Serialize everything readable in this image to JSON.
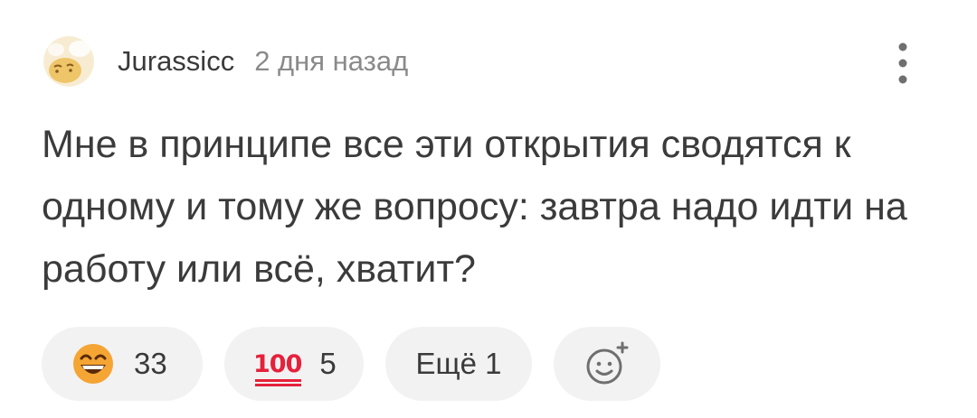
{
  "comment": {
    "author": {
      "name": "Jurassicc",
      "avatar_icon": "avatar-icon"
    },
    "timestamp": "2 дня назад",
    "text": "Мне в принципе все эти открытия сводятся к одному и тому же вопросу: завтра надо идти на работу или всё, хватит?",
    "more_icon": "more-vertical-icon"
  },
  "reactions": [
    {
      "icon": "grinning-face-icon",
      "count": "33"
    },
    {
      "icon": "hundred-points-icon",
      "count": "5"
    }
  ],
  "more_reactions_label": "Ещё 1",
  "add_reaction_icon": "add-emoji-icon",
  "colors": {
    "text": "#3b3b3b",
    "muted": "#8a8a8a",
    "chip_bg": "#f2f2f3",
    "hundred_red": "#e6213b"
  }
}
